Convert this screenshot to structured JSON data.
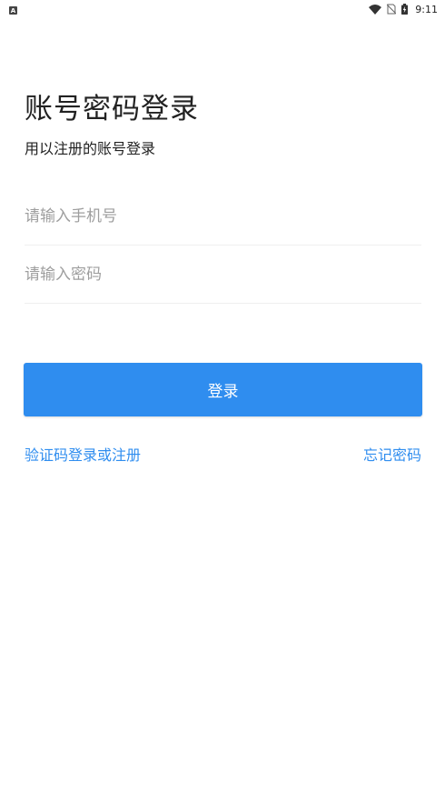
{
  "status_bar": {
    "left_badge": "A",
    "time": "9:11",
    "icons": [
      "wifi-icon",
      "no-sim-icon",
      "battery-charging-icon"
    ]
  },
  "login": {
    "title": "账号密码登录",
    "subtitle": "用以注册的账号登录",
    "phone_placeholder": "请输入手机号",
    "phone_value": "",
    "password_placeholder": "请输入密码",
    "password_value": "",
    "login_button": "登录",
    "sms_login_link": "验证码登录或注册",
    "forgot_password_link": "忘记密码"
  },
  "colors": {
    "accent": "#2f8def",
    "divider": "#efefef",
    "placeholder": "#9e9e9e"
  }
}
